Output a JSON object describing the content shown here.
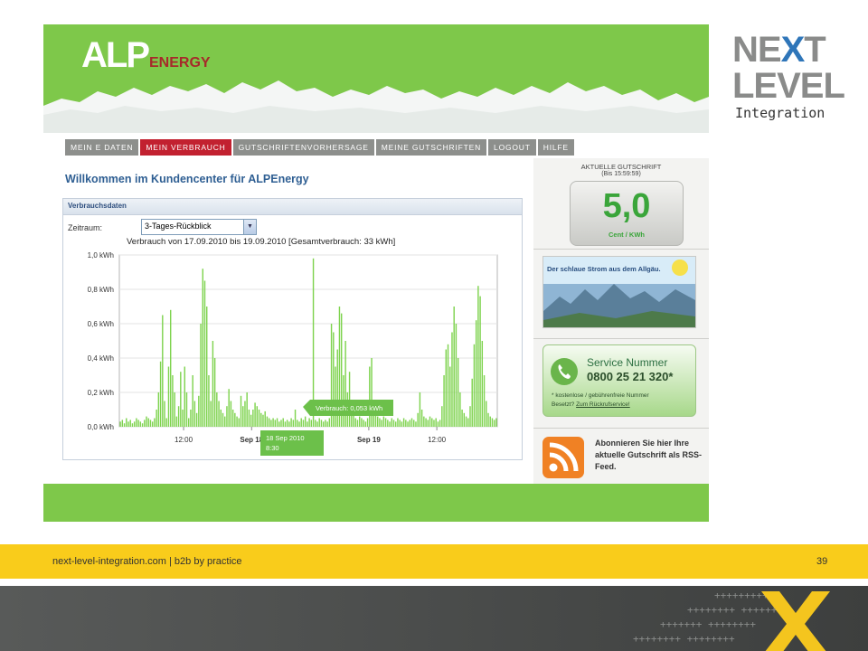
{
  "brand": {
    "alp_big": "ALP",
    "alp_small": "ENERGY"
  },
  "nav": [
    {
      "label": "MEIN E DATEN"
    },
    {
      "label": "MEIN VERBRAUCH",
      "active": true
    },
    {
      "label": "GUTSCHRIFTENVORHERSAGE"
    },
    {
      "label": "MEINE GUTSCHRIFTEN"
    },
    {
      "label": "LOGOUT"
    },
    {
      "label": "HILFE"
    }
  ],
  "welcome": "Willkommen im Kundencenter für ALPEnergy",
  "panel": {
    "title": "Verbrauchsdaten",
    "zeitraum_label": "Zeitraum:",
    "zeitraum_value": "3-Tages-Rückblick",
    "chart_title": "Verbrauch von 17.09.2010 bis 19.09.2010 [Gesamtverbrauch: 33 kWh]"
  },
  "chart_data": {
    "type": "bar",
    "y_ticks": [
      "1,0 kWh",
      "0,8 kWh",
      "0,6 kWh",
      "0,4 kWh",
      "0,2 kWh",
      "0,0 kWh"
    ],
    "ylim": [
      0,
      1.0
    ],
    "x_ticks": [
      "12:00",
      "Sep 18",
      "Sep 19",
      "12:00"
    ],
    "tooltip_value": "Verbrauch: 0,053 kWh",
    "tooltip_date": "18 Sep 2010",
    "tooltip_time": "8:30",
    "values": [
      0.03,
      0.04,
      0.02,
      0.05,
      0.03,
      0.04,
      0.02,
      0.03,
      0.05,
      0.04,
      0.03,
      0.02,
      0.04,
      0.06,
      0.05,
      0.04,
      0.03,
      0.05,
      0.1,
      0.2,
      0.38,
      0.65,
      0.15,
      0.05,
      0.35,
      0.68,
      0.3,
      0.2,
      0.06,
      0.12,
      0.32,
      0.1,
      0.35,
      0.2,
      0.05,
      0.1,
      0.3,
      0.15,
      0.08,
      0.18,
      0.6,
      0.92,
      0.85,
      0.7,
      0.3,
      0.15,
      0.5,
      0.4,
      0.2,
      0.15,
      0.1,
      0.08,
      0.06,
      0.12,
      0.22,
      0.15,
      0.1,
      0.08,
      0.06,
      0.05,
      0.18,
      0.12,
      0.15,
      0.2,
      0.1,
      0.07,
      0.1,
      0.14,
      0.12,
      0.1,
      0.08,
      0.07,
      0.09,
      0.06,
      0.05,
      0.04,
      0.05,
      0.04,
      0.05,
      0.03,
      0.04,
      0.05,
      0.03,
      0.04,
      0.03,
      0.05,
      0.04,
      0.1,
      0.04,
      0.03,
      0.05,
      0.04,
      0.06,
      0.03,
      0.05,
      0.04,
      0.98,
      0.04,
      0.03,
      0.05,
      0.04,
      0.03,
      0.04,
      0.03,
      0.05,
      0.6,
      0.55,
      0.35,
      0.45,
      0.7,
      0.66,
      0.3,
      0.5,
      0.2,
      0.32,
      0.1,
      0.08,
      0.05,
      0.04,
      0.06,
      0.05,
      0.04,
      0.03,
      0.05,
      0.35,
      0.4,
      0.12,
      0.08,
      0.06,
      0.05,
      0.04,
      0.06,
      0.05,
      0.04,
      0.03,
      0.05,
      0.04,
      0.03,
      0.05,
      0.04,
      0.03,
      0.05,
      0.04,
      0.03,
      0.04,
      0.05,
      0.04,
      0.03,
      0.08,
      0.2,
      0.1,
      0.06,
      0.05,
      0.04,
      0.06,
      0.05,
      0.04,
      0.05,
      0.03,
      0.04,
      0.12,
      0.3,
      0.45,
      0.48,
      0.35,
      0.55,
      0.7,
      0.6,
      0.4,
      0.2,
      0.1,
      0.08,
      0.06,
      0.05,
      0.12,
      0.28,
      0.48,
      0.62,
      0.82,
      0.76,
      0.5,
      0.3,
      0.15,
      0.08,
      0.06,
      0.05,
      0.04,
      0.05
    ]
  },
  "side": {
    "gutschrift_title": "AKTUELLE GUTSCHRIFT",
    "gutschrift_time": "(Bis 15:59:59)",
    "gutschrift_value": "5,0",
    "gutschrift_unit": "Cent / KWh",
    "ad_text": "Der schlaue Strom aus dem Allgäu.",
    "service_title": "Service Nummer",
    "service_number": "0800 25 21 320*",
    "service_note1": "* kostenlose / gebührenfreie Nummer",
    "service_note2_prefix": "Besetzt?",
    "service_note2_link": "Zum Rückrufservice!",
    "rss_text": "Abonnieren Sie hier Ihre aktuelle Gutschrift als RSS-Feed."
  },
  "nextlevel": {
    "line1_a": "NE",
    "line1_x": "X",
    "line1_b": "T",
    "line2": "LEVEL",
    "line3": "Integration"
  },
  "footer": {
    "text": "next-level-integration.com | b2b by practice",
    "page": "39"
  },
  "colors": {
    "green": "#7ec84a",
    "red": "#c22130",
    "yellow": "#f9cc1b",
    "bar_green": "#7ed34e"
  }
}
